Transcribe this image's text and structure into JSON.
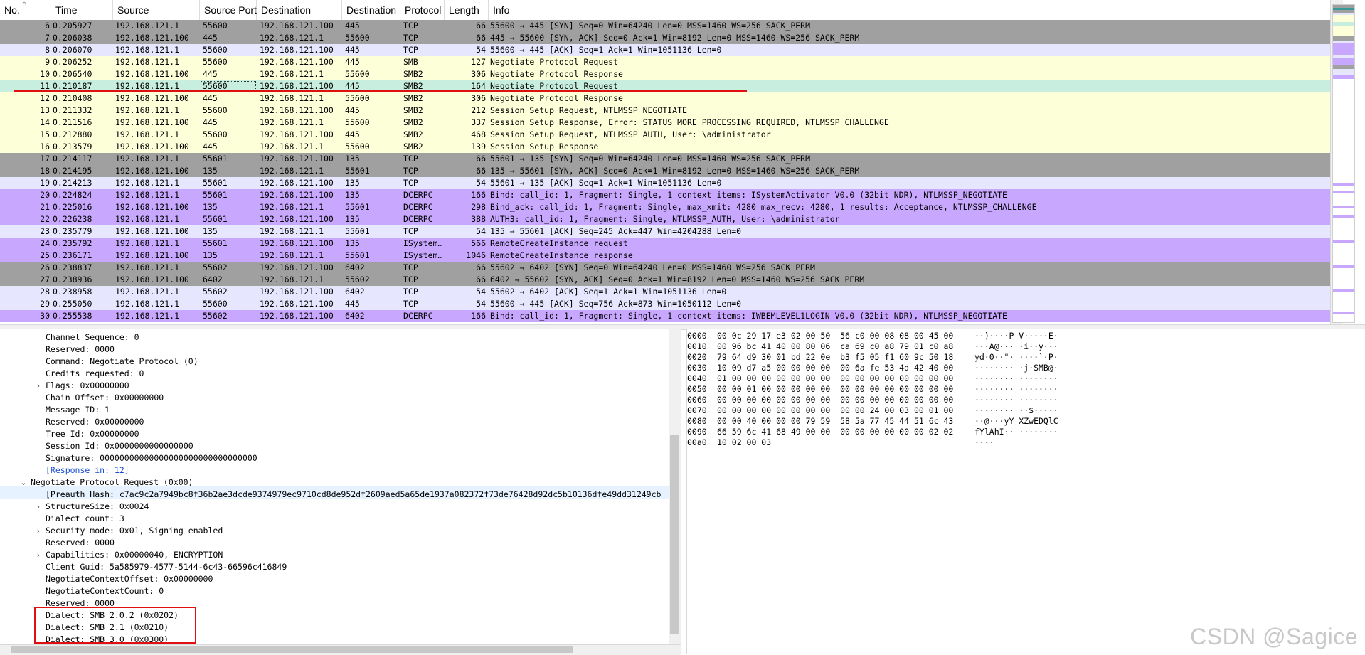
{
  "packet_list": {
    "columns": [
      "No.",
      "Time",
      "Source",
      "Source Port",
      "Destination",
      "Destination",
      "Protocol",
      "Length",
      "Info"
    ],
    "rows": [
      {
        "no": "6",
        "time": "0.205927",
        "src": "192.168.121.1",
        "sport": "55600",
        "dst": "192.168.121.100",
        "dport": "445",
        "proto": "TCP",
        "len": "66",
        "info": "55600 → 445 [SYN] Seq=0 Win=64240 Len=0 MSS=1460 WS=256 SACK_PERM",
        "color": "gray"
      },
      {
        "no": "7",
        "time": "0.206038",
        "src": "192.168.121.100",
        "sport": "445",
        "dst": "192.168.121.1",
        "dport": "55600",
        "proto": "TCP",
        "len": "66",
        "info": "445 → 55600 [SYN, ACK] Seq=0 Ack=1 Win=8192 Len=0 MSS=1460 WS=256 SACK_PERM",
        "color": "gray"
      },
      {
        "no": "8",
        "time": "0.206070",
        "src": "192.168.121.1",
        "sport": "55600",
        "dst": "192.168.121.100",
        "dport": "445",
        "proto": "TCP",
        "len": "54",
        "info": "55600 → 445 [ACK] Seq=1 Ack=1 Win=1051136 Len=0",
        "color": "lav"
      },
      {
        "no": "9",
        "time": "0.206252",
        "src": "192.168.121.1",
        "sport": "55600",
        "dst": "192.168.121.100",
        "dport": "445",
        "proto": "SMB",
        "len": "127",
        "info": "Negotiate Protocol Request",
        "color": "yellow"
      },
      {
        "no": "10",
        "time": "0.206540",
        "src": "192.168.121.100",
        "sport": "445",
        "dst": "192.168.121.1",
        "dport": "55600",
        "proto": "SMB2",
        "len": "306",
        "info": "Negotiate Protocol Response",
        "color": "yellow"
      },
      {
        "no": "11",
        "time": "0.210187",
        "src": "192.168.121.1",
        "sport": "55600",
        "dst": "192.168.121.100",
        "dport": "445",
        "proto": "SMB2",
        "len": "164",
        "info": "Negotiate Protocol Request",
        "color": "sel"
      },
      {
        "no": "12",
        "time": "0.210408",
        "src": "192.168.121.100",
        "sport": "445",
        "dst": "192.168.121.1",
        "dport": "55600",
        "proto": "SMB2",
        "len": "306",
        "info": "Negotiate Protocol Response",
        "color": "yellow"
      },
      {
        "no": "13",
        "time": "0.211332",
        "src": "192.168.121.1",
        "sport": "55600",
        "dst": "192.168.121.100",
        "dport": "445",
        "proto": "SMB2",
        "len": "212",
        "info": "Session Setup Request, NTLMSSP_NEGOTIATE",
        "color": "yellow"
      },
      {
        "no": "14",
        "time": "0.211516",
        "src": "192.168.121.100",
        "sport": "445",
        "dst": "192.168.121.1",
        "dport": "55600",
        "proto": "SMB2",
        "len": "337",
        "info": "Session Setup Response, Error: STATUS_MORE_PROCESSING_REQUIRED, NTLMSSP_CHALLENGE",
        "color": "yellow"
      },
      {
        "no": "15",
        "time": "0.212880",
        "src": "192.168.121.1",
        "sport": "55600",
        "dst": "192.168.121.100",
        "dport": "445",
        "proto": "SMB2",
        "len": "468",
        "info": "Session Setup Request, NTLMSSP_AUTH, User: \\administrator",
        "color": "yellow"
      },
      {
        "no": "16",
        "time": "0.213579",
        "src": "192.168.121.100",
        "sport": "445",
        "dst": "192.168.121.1",
        "dport": "55600",
        "proto": "SMB2",
        "len": "139",
        "info": "Session Setup Response",
        "color": "yellow"
      },
      {
        "no": "17",
        "time": "0.214117",
        "src": "192.168.121.1",
        "sport": "55601",
        "dst": "192.168.121.100",
        "dport": "135",
        "proto": "TCP",
        "len": "66",
        "info": "55601 → 135 [SYN] Seq=0 Win=64240 Len=0 MSS=1460 WS=256 SACK_PERM",
        "color": "gray"
      },
      {
        "no": "18",
        "time": "0.214195",
        "src": "192.168.121.100",
        "sport": "135",
        "dst": "192.168.121.1",
        "dport": "55601",
        "proto": "TCP",
        "len": "66",
        "info": "135 → 55601 [SYN, ACK] Seq=0 Ack=1 Win=8192 Len=0 MSS=1460 WS=256 SACK_PERM",
        "color": "gray"
      },
      {
        "no": "19",
        "time": "0.214213",
        "src": "192.168.121.1",
        "sport": "55601",
        "dst": "192.168.121.100",
        "dport": "135",
        "proto": "TCP",
        "len": "54",
        "info": "55601 → 135 [ACK] Seq=1 Ack=1 Win=1051136 Len=0",
        "color": "lav"
      },
      {
        "no": "20",
        "time": "0.224824",
        "src": "192.168.121.1",
        "sport": "55601",
        "dst": "192.168.121.100",
        "dport": "135",
        "proto": "DCERPC",
        "len": "166",
        "info": "Bind: call_id: 1, Fragment: Single, 1 context items: ISystemActivator V0.0 (32bit NDR), NTLMSSP_NEGOTIATE",
        "color": "purple"
      },
      {
        "no": "21",
        "time": "0.225016",
        "src": "192.168.121.100",
        "sport": "135",
        "dst": "192.168.121.1",
        "dport": "55601",
        "proto": "DCERPC",
        "len": "298",
        "info": "Bind_ack: call_id: 1, Fragment: Single, max_xmit: 4280 max_recv: 4280, 1 results: Acceptance, NTLMSSP_CHALLENGE",
        "color": "purple"
      },
      {
        "no": "22",
        "time": "0.226238",
        "src": "192.168.121.1",
        "sport": "55601",
        "dst": "192.168.121.100",
        "dport": "135",
        "proto": "DCERPC",
        "len": "388",
        "info": "AUTH3: call_id: 1, Fragment: Single, NTLMSSP_AUTH, User: \\administrator",
        "color": "purple"
      },
      {
        "no": "23",
        "time": "0.235779",
        "src": "192.168.121.100",
        "sport": "135",
        "dst": "192.168.121.1",
        "dport": "55601",
        "proto": "TCP",
        "len": "54",
        "info": "135 → 55601 [ACK] Seq=245 Ack=447 Win=4204288 Len=0",
        "color": "lav"
      },
      {
        "no": "24",
        "time": "0.235792",
        "src": "192.168.121.1",
        "sport": "55601",
        "dst": "192.168.121.100",
        "dport": "135",
        "proto": "ISystem…",
        "len": "566",
        "info": "RemoteCreateInstance request",
        "color": "purple"
      },
      {
        "no": "25",
        "time": "0.236171",
        "src": "192.168.121.100",
        "sport": "135",
        "dst": "192.168.121.1",
        "dport": "55601",
        "proto": "ISystem…",
        "len": "1046",
        "info": "RemoteCreateInstance response",
        "color": "purple"
      },
      {
        "no": "26",
        "time": "0.238837",
        "src": "192.168.121.1",
        "sport": "55602",
        "dst": "192.168.121.100",
        "dport": "6402",
        "proto": "TCP",
        "len": "66",
        "info": "55602 → 6402 [SYN] Seq=0 Win=64240 Len=0 MSS=1460 WS=256 SACK_PERM",
        "color": "gray"
      },
      {
        "no": "27",
        "time": "0.238936",
        "src": "192.168.121.100",
        "sport": "6402",
        "dst": "192.168.121.1",
        "dport": "55602",
        "proto": "TCP",
        "len": "66",
        "info": "6402 → 55602 [SYN, ACK] Seq=0 Ack=1 Win=8192 Len=0 MSS=1460 WS=256 SACK_PERM",
        "color": "gray"
      },
      {
        "no": "28",
        "time": "0.238958",
        "src": "192.168.121.1",
        "sport": "55602",
        "dst": "192.168.121.100",
        "dport": "6402",
        "proto": "TCP",
        "len": "54",
        "info": "55602 → 6402 [ACK] Seq=1 Ack=1 Win=1051136 Len=0",
        "color": "lav"
      },
      {
        "no": "29",
        "time": "0.255050",
        "src": "192.168.121.1",
        "sport": "55600",
        "dst": "192.168.121.100",
        "dport": "445",
        "proto": "TCP",
        "len": "54",
        "info": "55600 → 445 [ACK] Seq=756 Ack=873 Win=1050112 Len=0",
        "color": "lav"
      },
      {
        "no": "30",
        "time": "0.255538",
        "src": "192.168.121.1",
        "sport": "55602",
        "dst": "192.168.121.100",
        "dport": "6402",
        "proto": "DCERPC",
        "len": "166",
        "info": "Bind: call_id: 1, Fragment: Single, 1 context items: IWBEMLEVEL1LOGIN V0.0 (32bit NDR), NTLMSSP_NEGOTIATE",
        "color": "purple"
      }
    ]
  },
  "details": {
    "lines": [
      {
        "text": "Channel Sequence: 0",
        "indent": 2,
        "arrow": ""
      },
      {
        "text": "Reserved: 0000",
        "indent": 2,
        "arrow": ""
      },
      {
        "text": "Command: Negotiate Protocol (0)",
        "indent": 2,
        "arrow": ""
      },
      {
        "text": "Credits requested: 0",
        "indent": 2,
        "arrow": ""
      },
      {
        "text": "Flags: 0x00000000",
        "indent": 2,
        "arrow": "right"
      },
      {
        "text": "Chain Offset: 0x00000000",
        "indent": 2,
        "arrow": ""
      },
      {
        "text": "Message ID: 1",
        "indent": 2,
        "arrow": ""
      },
      {
        "text": "Reserved: 0x00000000",
        "indent": 2,
        "arrow": ""
      },
      {
        "text": "Tree Id: 0x00000000",
        "indent": 2,
        "arrow": ""
      },
      {
        "text": "Session Id: 0x0000000000000000",
        "indent": 2,
        "arrow": ""
      },
      {
        "text": "Signature: 00000000000000000000000000000000",
        "indent": 2,
        "arrow": ""
      },
      {
        "text": "[Response in: 12]",
        "indent": 2,
        "arrow": "",
        "link": true
      },
      {
        "text": "Negotiate Protocol Request (0x00)",
        "indent": 1,
        "arrow": "down"
      },
      {
        "text": "[Preauth Hash: c7ac9c2a7949bc8f36b2ae3dcde9374979ec9710cd8de952df2609aed5a65de1937a082372f73de76428d92dc5b10136dfe49dd31249cb",
        "indent": 2,
        "arrow": ""
      },
      {
        "text": "StructureSize: 0x0024",
        "indent": 2,
        "arrow": "right"
      },
      {
        "text": "Dialect count: 3",
        "indent": 2,
        "arrow": ""
      },
      {
        "text": "Security mode: 0x01, Signing enabled",
        "indent": 2,
        "arrow": "right"
      },
      {
        "text": "Reserved: 0000",
        "indent": 2,
        "arrow": ""
      },
      {
        "text": "Capabilities: 0x00000040, ENCRYPTION",
        "indent": 2,
        "arrow": "right"
      },
      {
        "text": "Client Guid: 5a585979-4577-5144-6c43-66596c416849",
        "indent": 2,
        "arrow": ""
      },
      {
        "text": "NegotiateContextOffset: 0x00000000",
        "indent": 2,
        "arrow": ""
      },
      {
        "text": "NegotiateContextCount: 0",
        "indent": 2,
        "arrow": ""
      },
      {
        "text": "Reserved: 0000",
        "indent": 2,
        "arrow": ""
      },
      {
        "text": "Dialect: SMB 2.0.2 (0x0202)",
        "indent": 2,
        "arrow": ""
      },
      {
        "text": "Dialect: SMB 2.1 (0x0210)",
        "indent": 2,
        "arrow": ""
      },
      {
        "text": "Dialect: SMB 3.0 (0x0300)",
        "indent": 2,
        "arrow": ""
      }
    ]
  },
  "bytes": {
    "lines": [
      {
        "offset": "0000",
        "hex": "00 0c 29 17 e3 02 00 50  56 c0 00 08 08 00 45 00",
        "ascii": "··)····P V·····E·"
      },
      {
        "offset": "0010",
        "hex": "00 96 bc 41 40 00 80 06  ca 69 c0 a8 79 01 c0 a8",
        "ascii": "···A@··· ·i··y···"
      },
      {
        "offset": "0020",
        "hex": "79 64 d9 30 01 bd 22 0e  b3 f5 05 f1 60 9c 50 18",
        "ascii": "yd·0··\"· ····`·P·"
      },
      {
        "offset": "0030",
        "hex": "10 09 d7 a5 00 00 00 00  00 6a fe 53 4d 42 40 00",
        "ascii": "········ ·j·SMB@·"
      },
      {
        "offset": "0040",
        "hex": "01 00 00 00 00 00 00 00  00 00 00 00 00 00 00 00",
        "ascii": "········ ········"
      },
      {
        "offset": "0050",
        "hex": "00 00 01 00 00 00 00 00  00 00 00 00 00 00 00 00",
        "ascii": "········ ········"
      },
      {
        "offset": "0060",
        "hex": "00 00 00 00 00 00 00 00  00 00 00 00 00 00 00 00",
        "ascii": "········ ········"
      },
      {
        "offset": "0070",
        "hex": "00 00 00 00 00 00 00 00  00 00 24 00 03 00 01 00",
        "ascii": "········ ··$·····"
      },
      {
        "offset": "0080",
        "hex": "00 00 40 00 00 00 79 59  58 5a 77 45 44 51 6c 43",
        "ascii": "··@···yY XZwEDQlC"
      },
      {
        "offset": "0090",
        "hex": "66 59 6c 41 68 49 00 00  00 00 00 00 00 00 02 02",
        "ascii": "fYlAhI·· ········"
      },
      {
        "offset": "00a0",
        "hex": "10 02 00 03",
        "ascii": "····"
      }
    ]
  },
  "watermark": "CSDN @Sagice",
  "colors": {
    "gray": "#a0a0a0",
    "lav": "#e7e6ff",
    "yellow": "#fcffd8",
    "purple": "#c8a8ff",
    "sel": "#c8eee0",
    "annotation_red": "#e01010"
  }
}
